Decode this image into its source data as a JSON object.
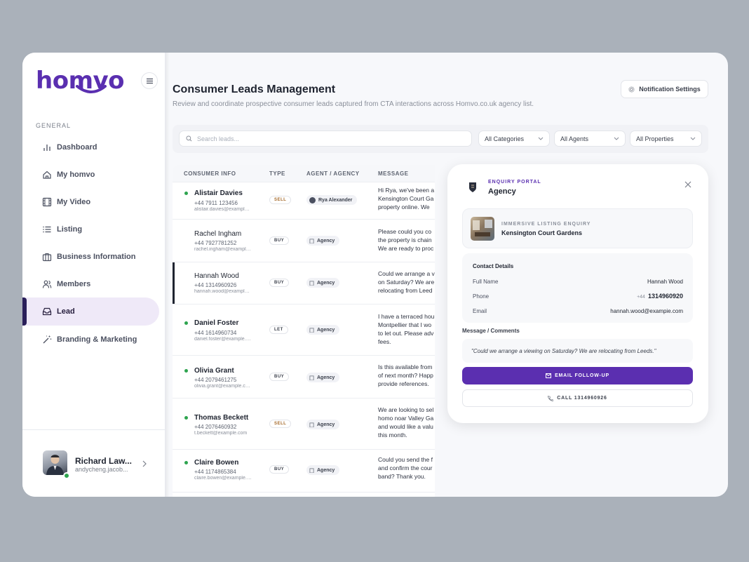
{
  "brand": {
    "logo_text": "homvo",
    "accent": "#5a2fb0"
  },
  "sidebar": {
    "section_label": "GENERAL",
    "items": [
      {
        "label": "Dashboard",
        "icon": "bar-chart-icon"
      },
      {
        "label": "My homvo",
        "icon": "home-icon"
      },
      {
        "label": "My Video",
        "icon": "film-icon"
      },
      {
        "label": "Listing",
        "icon": "list-icon"
      },
      {
        "label": "Business Information",
        "icon": "briefcase-icon"
      },
      {
        "label": "Members",
        "icon": "users-icon"
      },
      {
        "label": "Lead",
        "icon": "inbox-icon",
        "active": true
      },
      {
        "label": "Branding & Marketing",
        "icon": "magic-wand-icon"
      }
    ],
    "profile": {
      "name": "Richard Law...",
      "email": "andycheng.jacob..."
    }
  },
  "header": {
    "title": "Consumer Leads Management",
    "subtitle": "Review and coordinate prospective consumer leads captured from CTA interactions across Homvo.co.uk agency list.",
    "notification_button": "Notification Settings"
  },
  "filters": {
    "search_placeholder": "Search leads...",
    "categories": "All Categories",
    "agents": "All Agents",
    "properties": "All Properties"
  },
  "table": {
    "columns": [
      "CONSUMER INFO",
      "TYPE",
      "AGENT / AGENCY",
      "MESSAGE"
    ],
    "rows": [
      {
        "name": "Alistair Davies",
        "phone": "+44 7911 123456",
        "email": "alistair.davies@example.com",
        "type": "SELL",
        "agent": "Rya Alexander",
        "message": [
          "Hi Rya, we've been a",
          "Kensington Court Ga",
          "property online. We"
        ],
        "unread": true
      },
      {
        "name": "Rachel Ingham",
        "phone": "+44 7927781252",
        "email": "rachel.ingham@example.com",
        "type": "BUY",
        "agent": "Agency",
        "message": [
          "Please could you co",
          "the property is chain",
          "We are ready to proc"
        ],
        "unread": false
      },
      {
        "name": "Hannah Wood",
        "phone": "+44 1314960926",
        "email": "hannah.wood@example.com",
        "type": "BUY",
        "agent": "Agency",
        "message": [
          "Could we arrange a v",
          "on Saturday? We are",
          "relocating from Leed"
        ],
        "unread": false,
        "selected": true
      },
      {
        "name": "Daniel Foster",
        "phone": "+44 1614960734",
        "email": "daniel.foster@example.com",
        "type": "LET",
        "agent": "Agency",
        "message": [
          "I have a terraced hou",
          "Montpellier that I wo",
          "to let out. Please adv",
          "fees."
        ],
        "unread": true
      },
      {
        "name": "Olivia Grant",
        "phone": "+44 2079461275",
        "email": "olivia.grant@example.com",
        "type": "BUY",
        "agent": "Agency",
        "message": [
          "Is this available from",
          "of next month? Happ",
          "provide references."
        ],
        "unread": true
      },
      {
        "name": "Thomas Beckett",
        "phone": "+44 2076460932",
        "email": "t.beckett@example.com",
        "type": "SELL",
        "agent": "Agency",
        "message": [
          "We are looking to sel",
          "homo noar Valley Ga",
          "and would like a valu",
          "this month."
        ],
        "unread": true
      },
      {
        "name": "Claire Bowen",
        "phone": "+44 1174865384",
        "email": "claire.bowen@example.com",
        "type": "BUY",
        "agent": "Agency",
        "message": [
          "Could you send the f",
          "and confirm the cour",
          "band? Thank you."
        ],
        "unread": true
      }
    ]
  },
  "panel": {
    "eyebrow": "ENQUIRY PORTAL",
    "title": "Agency",
    "listing_eyebrow": "IMMERSIVE LISTING ENQUIRY",
    "listing_name": "Kensington Court Gardens",
    "contact_title": "Contact Details",
    "full_name_label": "Full Name",
    "full_name": "Hannah Wood",
    "phone_label": "Phone",
    "phone_prefix": "+44",
    "phone": "1314960920",
    "email_label": "Email",
    "email": "hannah.wood@exampie.com",
    "message_label": "Message / Comments",
    "message": "\"Could we arrange a viewing on Saturday? We are relocating from Leeds.\"",
    "email_button": "EMAIL FOLLOW-UP",
    "call_button": "CALL 1314960926"
  }
}
